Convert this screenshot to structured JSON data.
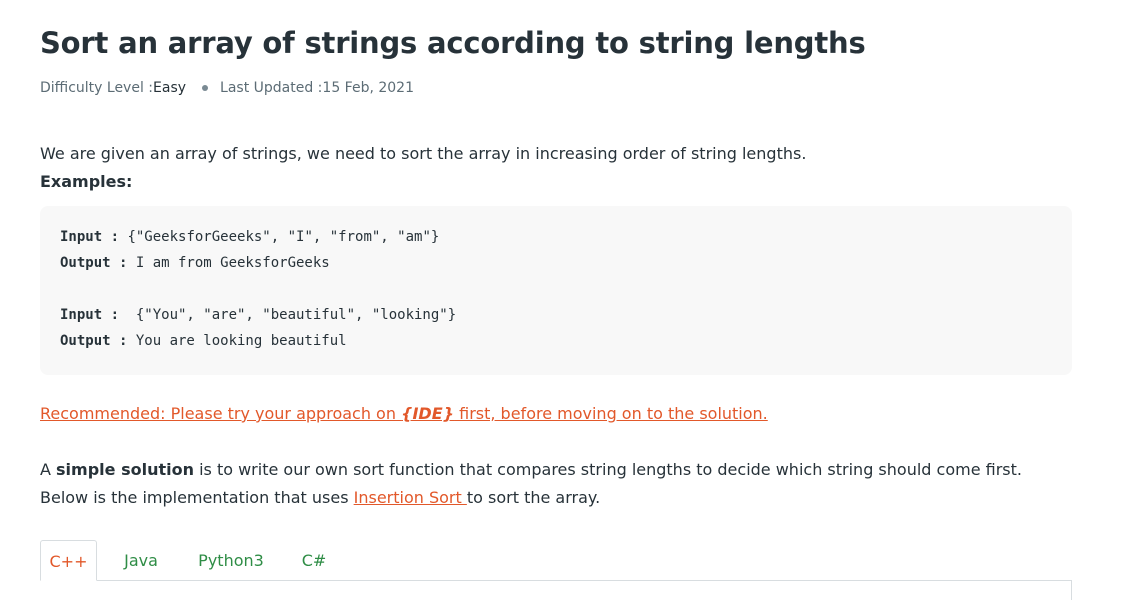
{
  "article": {
    "title": "Sort an array of strings according to string lengths",
    "meta": {
      "difficulty_label": "Difficulty Level : ",
      "difficulty_value": "Easy",
      "updated_label": "Last Updated : ",
      "updated_value": "15 Feb, 2021"
    },
    "intro": "We are given an array of strings, we need to sort the array in increasing order of string lengths.",
    "examples_label": "Examples:",
    "examples": [
      {
        "input_label": "Input : ",
        "input_value": "{\"GeeksforGeeeks\", \"I\", \"from\", \"am\"}",
        "output_label": "Output : ",
        "output_value": "I am from GeeksforGeeks"
      },
      {
        "input_label": "Input :  ",
        "input_value": "{\"You\", \"are\", \"beautiful\", \"looking\"}",
        "output_label": "Output : ",
        "output_value": "You are looking beautiful"
      }
    ],
    "recommended": {
      "before": "Recommended: Please try your approach on ",
      "ide": "{IDE}",
      "after": " first, before moving on to the solution."
    },
    "paragraph": {
      "p1": "A ",
      "bold": "simple solution",
      "p2": " is to write our own sort function that compares string lengths to decide which string should come first. Below is the implementation that uses ",
      "link": "Insertion Sort ",
      "p3": "to sort the array."
    },
    "tabs": [
      {
        "label": "C++",
        "active": true
      },
      {
        "label": "Java",
        "active": false
      },
      {
        "label": "Python3",
        "active": false
      },
      {
        "label": "C#",
        "active": false
      }
    ]
  },
  "colors": {
    "text": "#273239",
    "accent_orange": "#e2582a",
    "tab_green": "#2f8d46",
    "code_bg": "#f8f8f8"
  }
}
